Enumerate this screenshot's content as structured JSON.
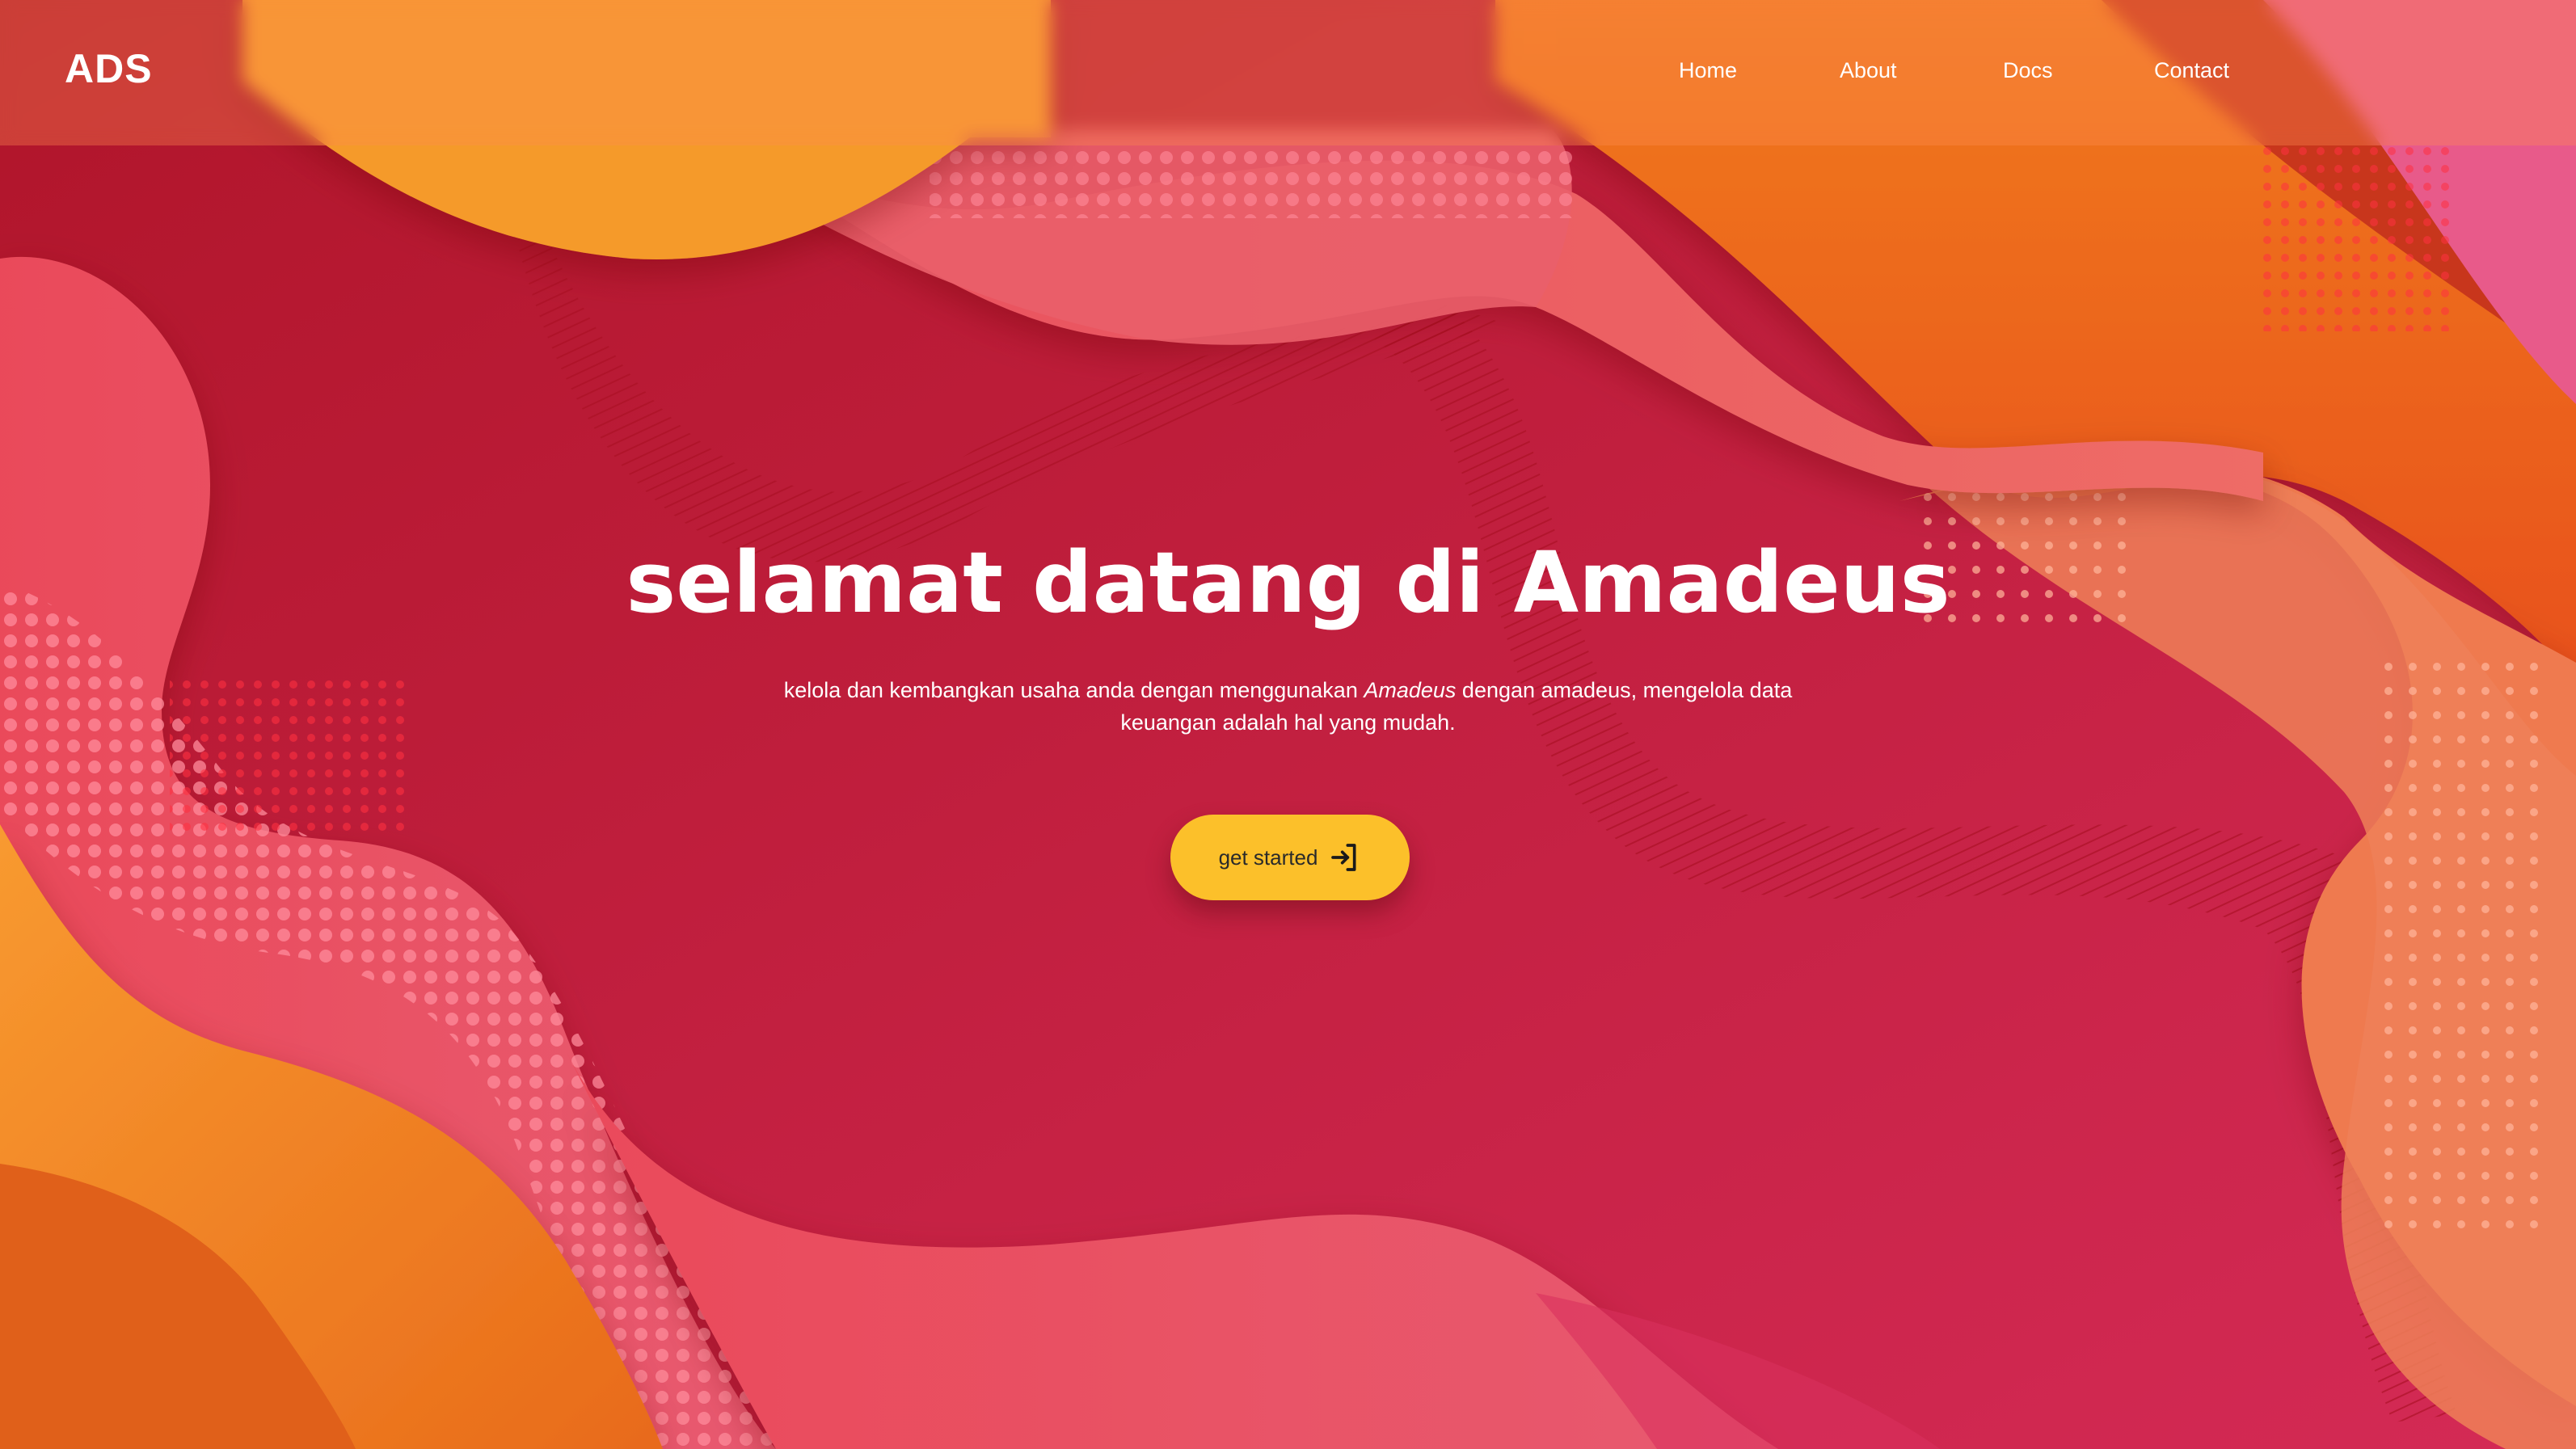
{
  "brand": {
    "name": "ADS"
  },
  "nav": {
    "items": [
      {
        "label": "Home"
      },
      {
        "label": "About"
      },
      {
        "label": "Docs"
      },
      {
        "label": "Contact"
      }
    ]
  },
  "hero": {
    "title": "selamat datang di Amadeus",
    "description_before": "kelola dan kembangkan usaha anda dengan menggunakan ",
    "description_emphasis": "Amadeus",
    "description_after": " dengan amadeus, mengelola data keuangan adalah hal yang mudah.",
    "cta_label": "get started",
    "cta_icon": "sign-in-icon"
  },
  "colors": {
    "background_red": "#b81a2e",
    "accent_orange": "#f59a2a",
    "accent_pink": "#ec5a6a",
    "button_yellow": "#fcc02a"
  }
}
